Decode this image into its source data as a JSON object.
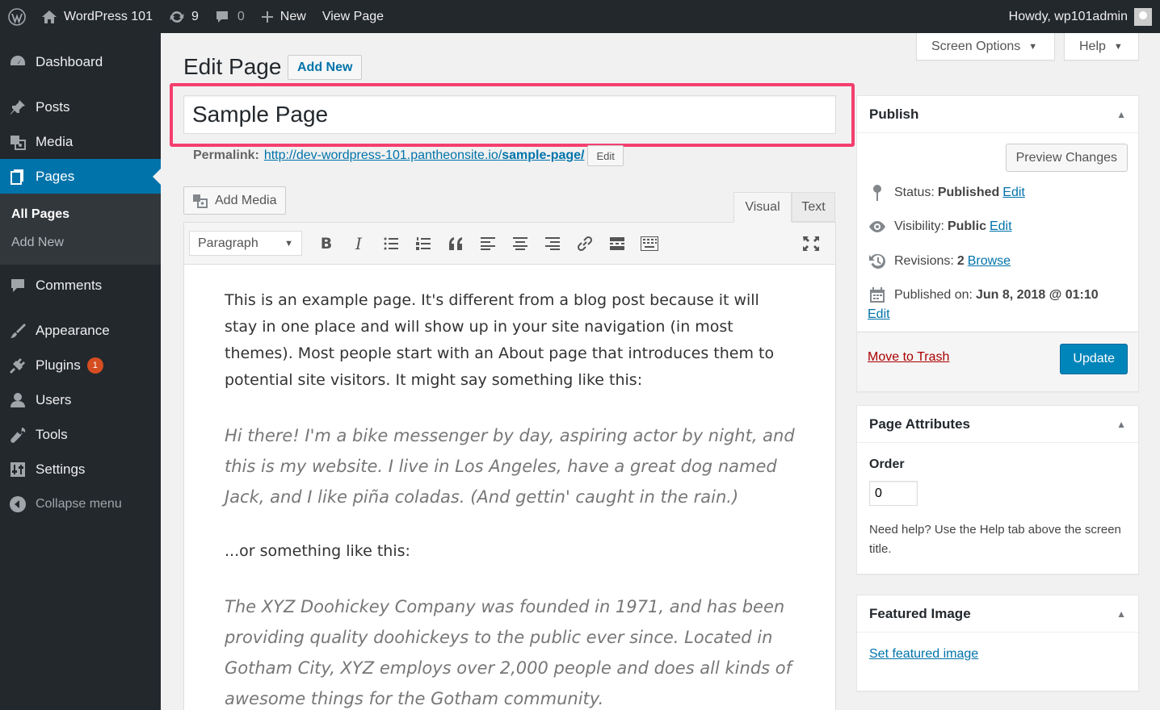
{
  "adminbar": {
    "site_name": "WordPress 101",
    "updates_count": "9",
    "comments_count": "0",
    "new_label": "New",
    "view_label": "View Page",
    "howdy": "Howdy, wp101admin"
  },
  "sidebar": {
    "items": [
      {
        "label": "Dashboard"
      },
      {
        "label": "Posts"
      },
      {
        "label": "Media"
      },
      {
        "label": "Pages"
      },
      {
        "label": "Comments"
      },
      {
        "label": "Appearance"
      },
      {
        "label": "Plugins",
        "badge": "1"
      },
      {
        "label": "Users"
      },
      {
        "label": "Tools"
      },
      {
        "label": "Settings"
      }
    ],
    "submenu": [
      "All Pages",
      "Add New"
    ],
    "collapse_label": "Collapse menu"
  },
  "screen_tabs": {
    "screen_options": "Screen Options",
    "help": "Help"
  },
  "page": {
    "heading": "Edit Page",
    "add_new": "Add New",
    "title_value": "Sample Page",
    "permalink_label": "Permalink:",
    "permalink_base": "http://dev-wordpress-101.pantheonsite.io/",
    "permalink_slug": "sample-page/",
    "permalink_edit": "Edit"
  },
  "editor": {
    "add_media": "Add Media",
    "tab_visual": "Visual",
    "tab_text": "Text",
    "format": "Paragraph",
    "content": {
      "p1": "This is an example page. It's different from a blog post because it will stay in one place and will show up in your site navigation (in most themes). Most people start with an About page that introduces them to potential site visitors. It might say something like this:",
      "quote1": "Hi there! I'm a bike messenger by day, aspiring actor by night, and this is my website. I live in Los Angeles, have a great dog named Jack, and I like piña coladas. (And gettin' caught in the rain.)",
      "p2": "...or something like this:",
      "quote2": "The XYZ Doohickey Company was founded in 1971, and has been providing quality doohickeys to the public ever since. Located in Gotham City, XYZ employs over 2,000 people and does all kinds of awesome things for the Gotham community."
    }
  },
  "publish": {
    "title": "Publish",
    "preview": "Preview Changes",
    "status_label": "Status:",
    "status_value": "Published",
    "visibility_label": "Visibility:",
    "visibility_value": "Public",
    "revisions_label": "Revisions:",
    "revisions_value": "2",
    "browse": "Browse",
    "published_label": "Published on:",
    "published_value": "Jun 8, 2018 @ 01:10",
    "edit": "Edit",
    "trash": "Move to Trash",
    "update": "Update"
  },
  "page_attributes": {
    "title": "Page Attributes",
    "order_label": "Order",
    "order_value": "0",
    "help": "Need help? Use the Help tab above the screen title."
  },
  "featured_image": {
    "title": "Featured Image",
    "link": "Set featured image"
  },
  "colors": {
    "adminbar_bg": "#23282d",
    "accent": "#0073aa",
    "highlight": "#f43f6f",
    "update_button": "#0085ba",
    "trash": "#aa0000"
  }
}
